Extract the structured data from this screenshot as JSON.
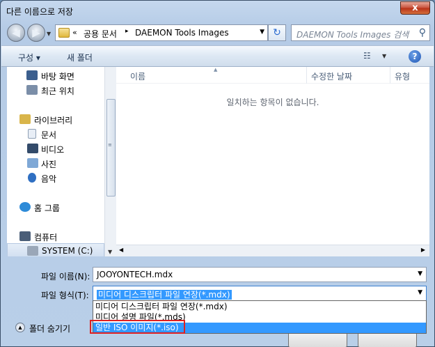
{
  "window": {
    "title": "다른 이름으로 저장",
    "close_label": "x"
  },
  "nav": {
    "back": "◀",
    "forward": "▶",
    "breadcrumb_prefix": "«",
    "crumbs": [
      "공용 문서",
      "DAEMON Tools Images"
    ],
    "crumb_separator": "▸",
    "refresh_icon": "↻",
    "search_placeholder": "DAEMON Tools Images 검색",
    "search_icon": "⚲"
  },
  "toolbar": {
    "organize": "구성 ▾",
    "new_folder": "새 폴더",
    "views_icon": "☷",
    "help": "?"
  },
  "sidebar": {
    "items": [
      {
        "label": "바탕 화면",
        "icon": "desktop-icon",
        "color": "#3c5f8e"
      },
      {
        "label": "최근 위치",
        "icon": "recent-places-icon",
        "color": "#7b8ea8"
      },
      {
        "label": "라이브러리",
        "icon": "libraries-icon",
        "color": "#d9b54a"
      },
      {
        "label": "문서",
        "icon": "documents-icon",
        "color": "#e8eef6"
      },
      {
        "label": "비디오",
        "icon": "videos-icon",
        "color": "#334b6a"
      },
      {
        "label": "사진",
        "icon": "pictures-icon",
        "color": "#7fa8d6"
      },
      {
        "label": "음악",
        "icon": "music-icon",
        "color": "#2f6fc2"
      },
      {
        "label": "홈 그룹",
        "icon": "homegroup-icon",
        "color": "#2e8bd8"
      },
      {
        "label": "컴퓨터",
        "icon": "computer-icon",
        "color": "#4a5e78"
      },
      {
        "label": "SYSTEM (C:)",
        "icon": "drive-icon",
        "color": "#9aa7b8"
      }
    ]
  },
  "filelist": {
    "columns": [
      "이름",
      "수정한 날짜",
      "유형"
    ],
    "empty_message": "일치하는 항목이 없습니다."
  },
  "form": {
    "filename_label": "파일 이름(N):",
    "filename_value": "JOOYONTECH.mdx",
    "filetype_label": "파일 형식(T):",
    "filetype_value": "미디어 디스크립터 파일 연장(*.mdx)",
    "filetype_options": [
      "미디어 디스크립터 파일 연장(*.mdx)",
      "미디어 설명 파일(*.mds)",
      "일반 ISO 이미지(*.iso)"
    ],
    "hide_folders": "폴더 숨기기"
  }
}
